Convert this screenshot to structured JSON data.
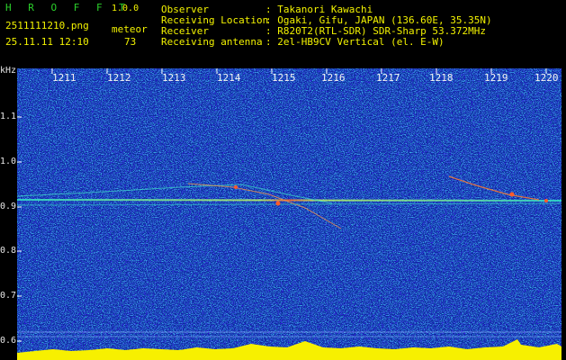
{
  "header": {
    "app_name": "H R O F F T",
    "version": "1.0.0",
    "filename": "2511111210.png",
    "mode": "meteor",
    "datetime": "25.11.11 12:10",
    "count": "73",
    "info": [
      {
        "label": "Observer",
        "value": ": Takanori Kawachi"
      },
      {
        "label": "Receiving Location",
        "value": ": Ogaki, Gifu, JAPAN (136.60E, 35.35N)"
      },
      {
        "label": "Receiver",
        "value": ": R820T2(RTL-SDR) SDR-Sharp 53.372MHz"
      },
      {
        "label": "Receiving antenna",
        "value": ": 2el-HB9CV Vertical (el. E-W)"
      }
    ]
  },
  "axes": {
    "y_unit": "kHz",
    "y_ticks": [
      "1.1",
      "1.0",
      "0.9",
      "0.8",
      "0.7",
      "0.6"
    ],
    "x_ticks": [
      "1211",
      "1212",
      "1213",
      "1214",
      "1215",
      "1216",
      "1217",
      "1218",
      "1219",
      "1220"
    ]
  },
  "colors": {
    "background": "#0b2a9c",
    "header_green": "#2bd12b",
    "header_yellow": "#f2f200",
    "carrier": "#39e0d0",
    "hotspot": "#ff5a2a",
    "bottom_bar": "#f7f000"
  }
}
